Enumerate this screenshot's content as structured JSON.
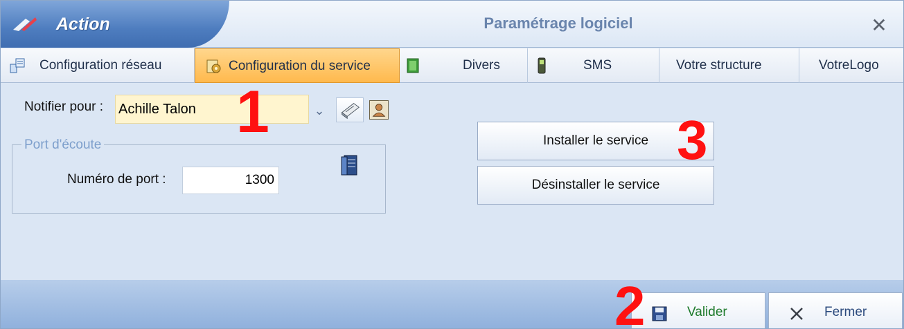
{
  "titlebar": {
    "app_label": "Action",
    "window_title": "Paramétrage logiciel",
    "close_glyph": "✕"
  },
  "tabs": [
    {
      "label": "Configuration réseau",
      "icon": "network-config-icon",
      "active": false
    },
    {
      "label": "Configuration du service",
      "icon": "service-config-icon",
      "active": true
    },
    {
      "label": "Divers",
      "icon": "notebook-icon",
      "active": false
    },
    {
      "label": "SMS",
      "icon": "mobile-phone-icon",
      "active": false
    },
    {
      "label": "Votre structure",
      "icon": "",
      "active": false
    },
    {
      "label": "VotreLogo",
      "icon": "",
      "active": false
    }
  ],
  "form": {
    "notify_label": "Notifier pour :",
    "notify_value": "Achille Talon",
    "dropdown_glyph": "⌄",
    "port_group_label": "Port d'écoute",
    "port_label": "Numéro de port :",
    "port_value": "1300"
  },
  "service_buttons": {
    "install_label": "Installer le service",
    "uninstall_label": "Désinstaller le service"
  },
  "footer": {
    "valider_label": "Valider",
    "fermer_label": "Fermer"
  },
  "annotations": {
    "one": "1",
    "two": "2",
    "three": "3"
  },
  "colors": {
    "accent_tab": "#ffb94d",
    "annotation": "#ff1111",
    "title_text": "#6a85ad"
  }
}
